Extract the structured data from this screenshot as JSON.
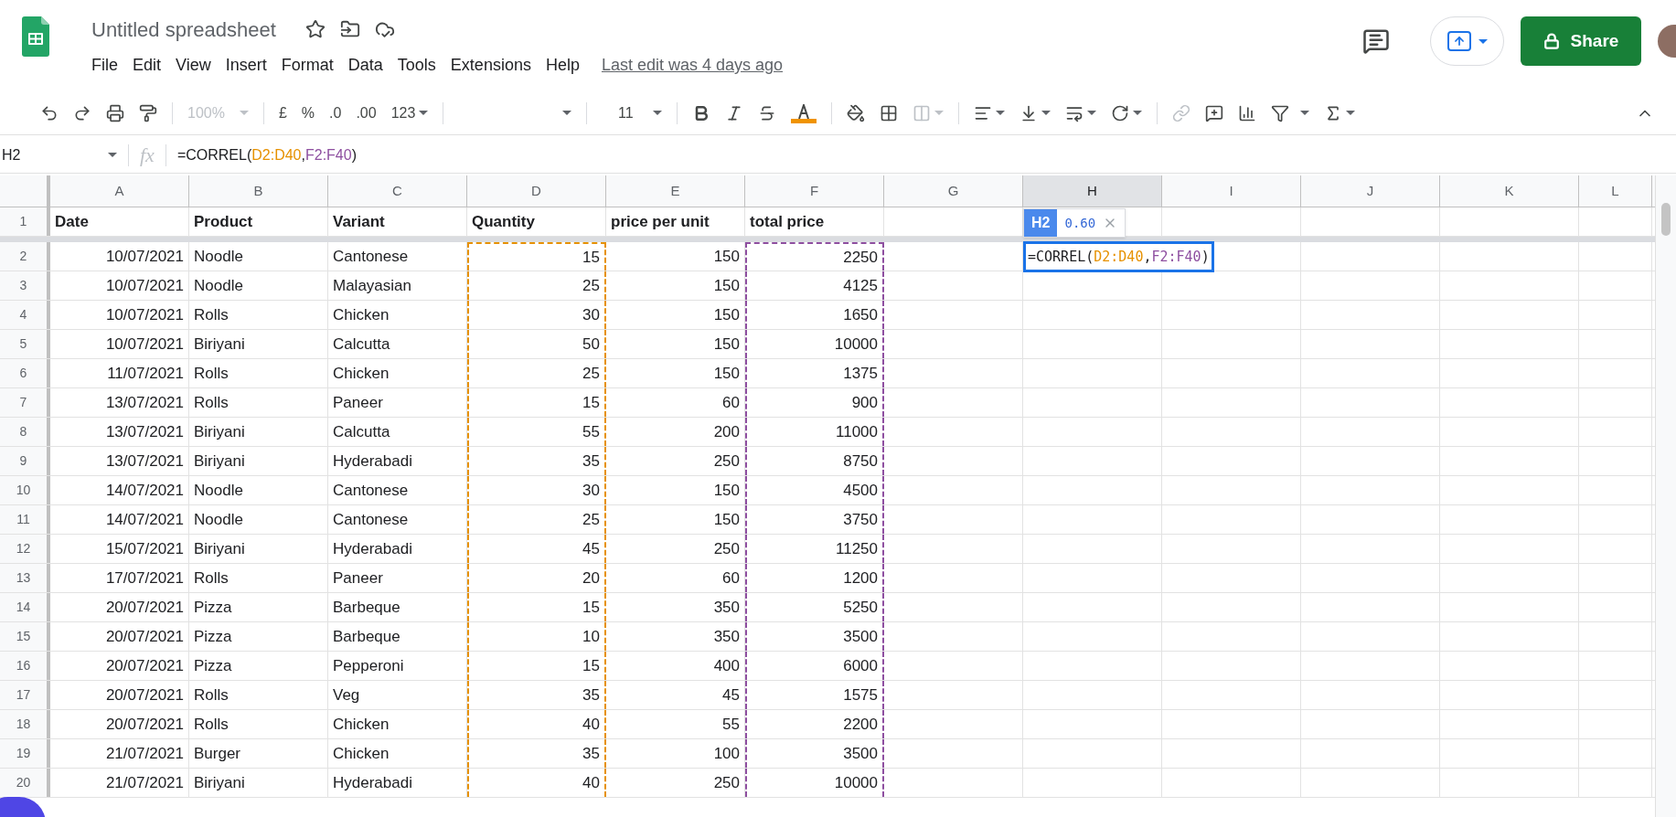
{
  "doc": {
    "title": "Untitled spreadsheet",
    "last_edit": "Last edit was 4 days ago"
  },
  "menu": [
    "File",
    "Edit",
    "View",
    "Insert",
    "Format",
    "Data",
    "Tools",
    "Extensions",
    "Help"
  ],
  "share": "Share",
  "toolbar": {
    "zoom": "100%",
    "currency": "£",
    "percent": "%",
    "dec_less": ".0",
    "dec_more": ".00",
    "format": "123",
    "font_size": "11"
  },
  "formula_bar": {
    "name_box": "H2",
    "fx": "fx",
    "tokens": [
      {
        "text": "=CORREL("
      },
      {
        "text": "D2:D40",
        "color": "#e69100"
      },
      {
        "text": ","
      },
      {
        "text": "F2:F40",
        "color": "#8e4fa0"
      },
      {
        "text": ")"
      }
    ]
  },
  "columns": [
    {
      "label": "A",
      "selected": false
    },
    {
      "label": "B",
      "selected": false
    },
    {
      "label": "C",
      "selected": false
    },
    {
      "label": "D",
      "selected": false,
      "color": "#e69100"
    },
    {
      "label": "E",
      "selected": false
    },
    {
      "label": "F",
      "selected": false,
      "color": "#8e4fa0"
    },
    {
      "label": "G",
      "selected": false
    },
    {
      "label": "H",
      "selected": true
    },
    {
      "label": "I",
      "selected": false
    },
    {
      "label": "J",
      "selected": false
    },
    {
      "label": "K",
      "selected": false
    },
    {
      "label": "L",
      "selected": false
    }
  ],
  "header_row": {
    "number": "1",
    "cells": [
      "Date",
      "Product",
      "Variant",
      "Quantity",
      "price per unit",
      "total price"
    ]
  },
  "rows": [
    {
      "number": "2",
      "cells": [
        "10/07/2021",
        "Noodle",
        "Cantonese",
        "15",
        "150",
        "2250"
      ],
      "editor": {
        "ref": "H2",
        "preview": "0.60",
        "tokens": [
          {
            "text": "=CORREL("
          },
          {
            "text": "D2:D40",
            "color": "#e69100"
          },
          {
            "text": ","
          },
          {
            "text": "F2:F40",
            "color": "#8e4fa0"
          },
          {
            "text": ")"
          }
        ]
      }
    },
    {
      "number": "3",
      "cells": [
        "10/07/2021",
        "Noodle",
        "Malayasian",
        "25",
        "150",
        "4125"
      ]
    },
    {
      "number": "4",
      "cells": [
        "10/07/2021",
        "Rolls",
        "Chicken",
        "30",
        "150",
        "1650"
      ]
    },
    {
      "number": "5",
      "cells": [
        "10/07/2021",
        "Biriyani",
        "Calcutta",
        "50",
        "150",
        "10000"
      ]
    },
    {
      "number": "6",
      "cells": [
        "11/07/2021",
        "Rolls",
        "Chicken",
        "25",
        "150",
        "1375"
      ]
    },
    {
      "number": "7",
      "cells": [
        "13/07/2021",
        "Rolls",
        "Paneer",
        "15",
        "60",
        "900"
      ]
    },
    {
      "number": "8",
      "cells": [
        "13/07/2021",
        "Biriyani",
        "Calcutta",
        "55",
        "200",
        "11000"
      ]
    },
    {
      "number": "9",
      "cells": [
        "13/07/2021",
        "Biriyani",
        "Hyderabadi",
        "35",
        "250",
        "8750"
      ]
    },
    {
      "number": "10",
      "cells": [
        "14/07/2021",
        "Noodle",
        "Cantonese",
        "30",
        "150",
        "4500"
      ]
    },
    {
      "number": "11",
      "cells": [
        "14/07/2021",
        "Noodle",
        "Cantonese",
        "25",
        "150",
        "3750"
      ]
    },
    {
      "number": "12",
      "cells": [
        "15/07/2021",
        "Biriyani",
        "Hyderabadi",
        "45",
        "250",
        "11250"
      ]
    },
    {
      "number": "13",
      "cells": [
        "17/07/2021",
        "Rolls",
        "Paneer",
        "20",
        "60",
        "1200"
      ]
    },
    {
      "number": "14",
      "cells": [
        "20/07/2021",
        "Pizza",
        "Barbeque",
        "15",
        "350",
        "5250"
      ]
    },
    {
      "number": "15",
      "cells": [
        "20/07/2021",
        "Pizza",
        "Barbeque",
        "10",
        "350",
        "3500"
      ]
    },
    {
      "number": "16",
      "cells": [
        "20/07/2021",
        "Pizza",
        "Pepperoni",
        "15",
        "400",
        "6000"
      ]
    },
    {
      "number": "17",
      "cells": [
        "20/07/2021",
        "Rolls",
        "Veg",
        "35",
        "45",
        "1575"
      ]
    },
    {
      "number": "18",
      "cells": [
        "20/07/2021",
        "Rolls",
        "Chicken",
        "40",
        "55",
        "2200"
      ]
    },
    {
      "number": "19",
      "cells": [
        "21/07/2021",
        "Burger",
        "Chicken",
        "35",
        "100",
        "3500"
      ]
    },
    {
      "number": "20",
      "cells": [
        "21/07/2021",
        "Biriyani",
        "Hyderabadi",
        "40",
        "250",
        "10000"
      ]
    }
  ]
}
